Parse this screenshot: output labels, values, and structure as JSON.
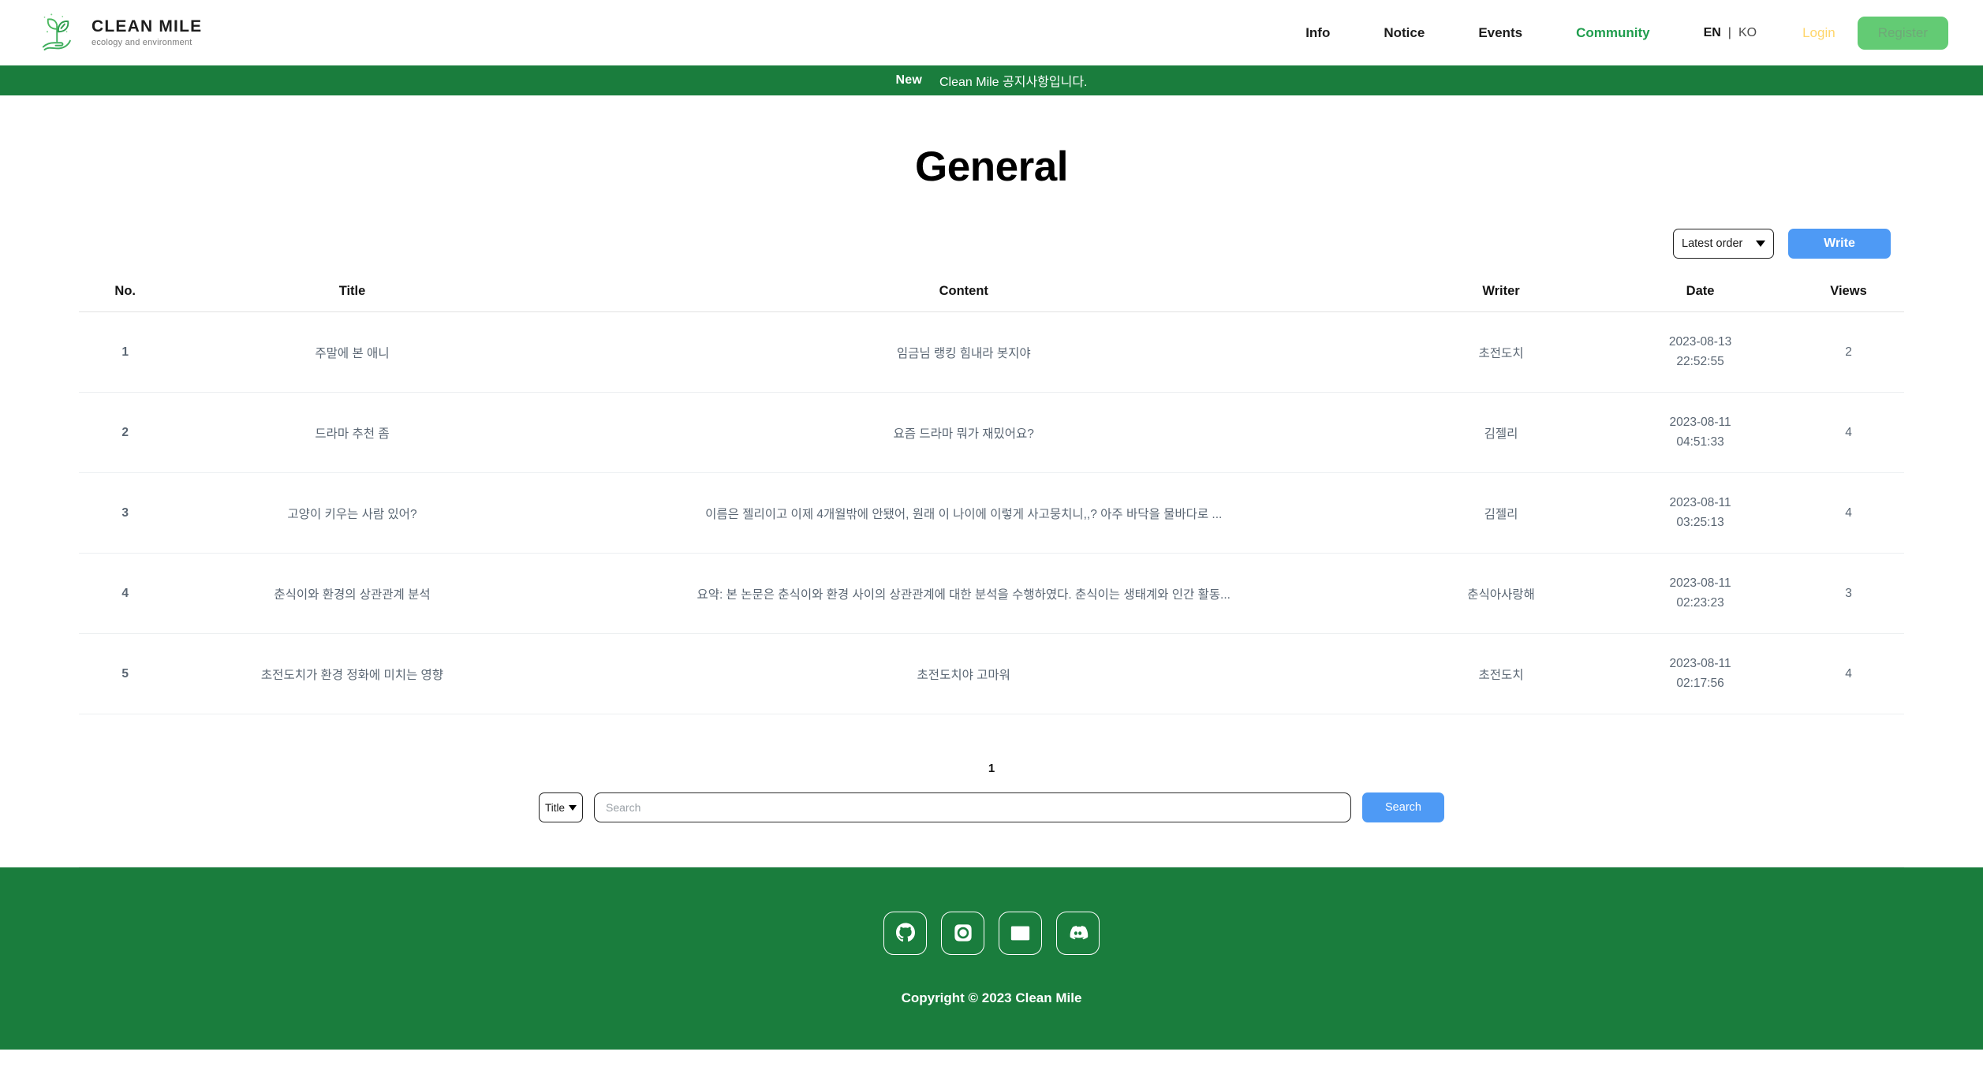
{
  "brand": {
    "title": "CLEAN MILE",
    "tagline": "ecology and environment",
    "logo_icon": "hand-holding-plant-icon"
  },
  "nav": {
    "links": [
      {
        "label": "Info",
        "active": false
      },
      {
        "label": "Notice",
        "active": false
      },
      {
        "label": "Events",
        "active": false
      },
      {
        "label": "Community",
        "active": true
      }
    ],
    "lang_en": "EN",
    "lang_sep": "|",
    "lang_ko": "KO",
    "login_label": "Login",
    "register_label": "Register"
  },
  "notice": {
    "tag": "New",
    "text": "Clean Mile 공지사항입니다."
  },
  "page": {
    "title": "General"
  },
  "toolbar": {
    "order_value": "Latest order",
    "write_label": "Write"
  },
  "table": {
    "headers": [
      "No.",
      "Title",
      "Content",
      "Writer",
      "Date",
      "Views"
    ],
    "rows": [
      {
        "no": "1",
        "title": "주말에 본 애니",
        "content": "임금님 랭킹 힘내라 봇지야",
        "writer": "초전도치",
        "date": "2023-08-13",
        "time": "22:52:55",
        "views": "2"
      },
      {
        "no": "2",
        "title": "드라마 추천 좀",
        "content": "요즘 드라마 뭐가 재밌어요?",
        "writer": "김젤리",
        "date": "2023-08-11",
        "time": "04:51:33",
        "views": "4"
      },
      {
        "no": "3",
        "title": "고양이 키우는 사람 있어?",
        "content": "이름은 젤리이고 이제 4개월밖에 안됐어, 원래 이 나이에 이렇게 사고뭉치니,,? 아주 바닥을 물바다로 ...",
        "writer": "김젤리",
        "date": "2023-08-11",
        "time": "03:25:13",
        "views": "4"
      },
      {
        "no": "4",
        "title": "춘식이와 환경의 상관관계 분석",
        "content": "요약: 본 논문은 춘식이와 환경 사이의 상관관계에 대한 분석을 수행하였다. 춘식이는 생태계와 인간 활동...",
        "writer": "춘식아사랑해",
        "date": "2023-08-11",
        "time": "02:23:23",
        "views": "3"
      },
      {
        "no": "5",
        "title": "초전도치가 환경 정화에 미치는 영향",
        "content": "초전도치야 고마워",
        "writer": "초전도치",
        "date": "2023-08-11",
        "time": "02:17:56",
        "views": "4"
      }
    ]
  },
  "pagination": {
    "current": "1"
  },
  "search": {
    "field_value": "Title",
    "input_value": "",
    "placeholder": "Search",
    "button_label": "Search"
  },
  "footer": {
    "socials": [
      {
        "name": "github-icon"
      },
      {
        "name": "instagram-icon"
      },
      {
        "name": "email-icon"
      },
      {
        "name": "discord-icon"
      }
    ],
    "copyright": "Copyright © 2023 Clean Mile"
  },
  "colors": {
    "green": "#1a7d3d",
    "accent_green": "#1f9d4d",
    "blue": "#4e9af5",
    "register_green": "#63cb74",
    "login_yellow": "#ffd66b"
  }
}
